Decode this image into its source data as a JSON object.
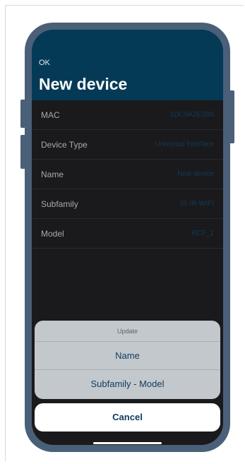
{
  "header": {
    "back_label": "OK",
    "title": "New device"
  },
  "device_fields": [
    {
      "label": "MAC",
      "value": "1DC9A2E2B8"
    },
    {
      "label": "Device Type",
      "value": "Universal Interface"
    },
    {
      "label": "Name",
      "value": "New device"
    },
    {
      "label": "Subfamily",
      "value": "IS-IR-WIFI"
    },
    {
      "label": "Model",
      "value": "RCF_1"
    }
  ],
  "action_sheet": {
    "title": "Update",
    "actions": [
      "Name",
      "Subfamily - Model"
    ],
    "cancel_label": "Cancel"
  },
  "colors": {
    "header_bg": "#053a57",
    "screen_bg": "#1a1a1c",
    "phone_frame": "#4a5f78",
    "accent_text": "#0f3b5e"
  }
}
